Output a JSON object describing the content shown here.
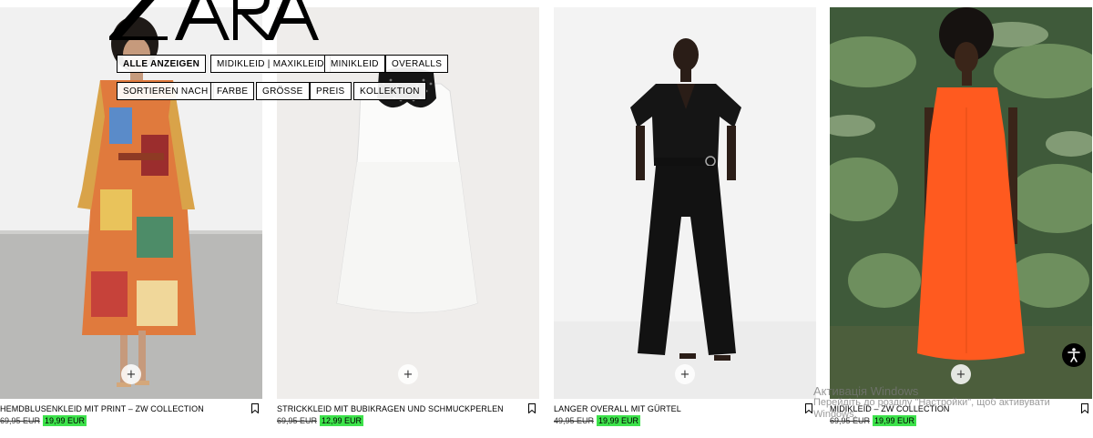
{
  "brand": {
    "name": "ZARA"
  },
  "filters": {
    "row1": [
      "ALLE ANZEIGEN",
      "MIDIKLEID | MAXIKLEID",
      "MINIKLEID",
      "OVERALLS"
    ],
    "row2": [
      "SORTIEREN NACH",
      "FARBE",
      "GRÖSSE",
      "PREIS",
      "KOLLEKTION"
    ]
  },
  "products": [
    {
      "name": "HEMDBLUSENKLEID MIT PRINT – ZW COLLECTION",
      "old_price": "69,95 EUR",
      "price": "19,99 EUR",
      "add_label": "+"
    },
    {
      "name": "STRICKKLEID MIT BUBIKRAGEN UND SCHMUCKPERLEN",
      "old_price": "69,95 EUR",
      "price": "12,99 EUR",
      "add_label": "+"
    },
    {
      "name": "LANGER OVERALL MIT GÜRTEL",
      "old_price": "49,95 EUR",
      "price": "19,99 EUR",
      "add_label": "+"
    },
    {
      "name": "MIDIKLEID – ZW COLLECTION",
      "old_price": "69,95 EUR",
      "price": "19,99 EUR",
      "add_label": "+"
    }
  ],
  "watermark": {
    "line1": "Активація Windows",
    "line2": "Перейдіть до розділу \"Настройки\", щоб активувати",
    "line3": "Windows."
  },
  "colors": {
    "sale_highlight": "#3de24b",
    "dress_orange": "#ff5a1f"
  },
  "icons": [
    "bookmark-icon",
    "plus-icon",
    "accessibility-icon"
  ]
}
